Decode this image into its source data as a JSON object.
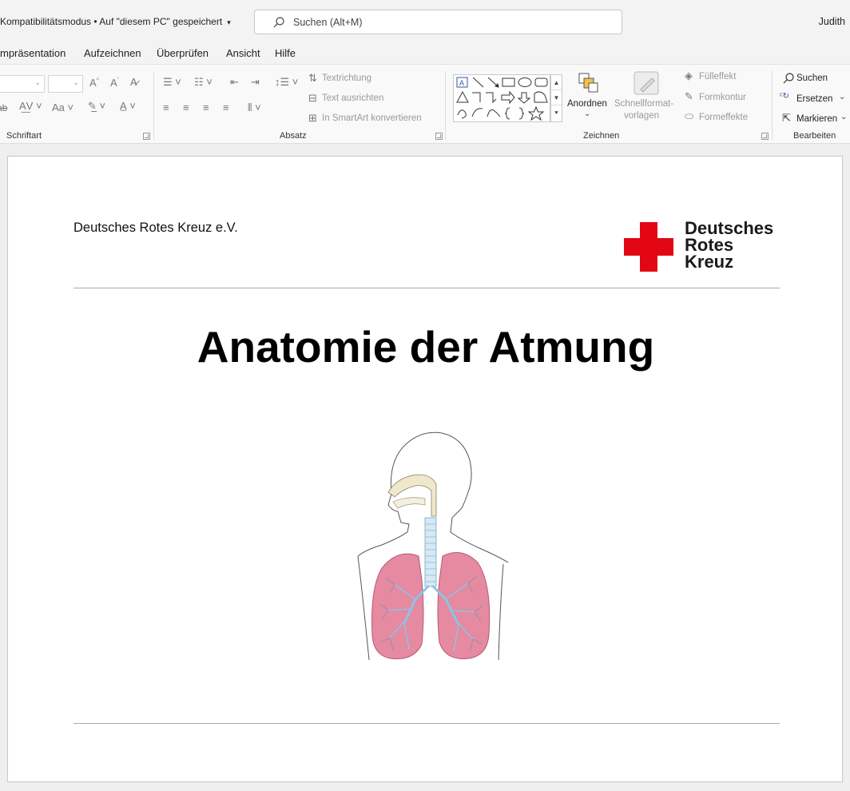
{
  "titlebar": {
    "doc_title": "Kompatibilitätsmodus • Auf \"diesem PC\" gespeichert",
    "search_placeholder": "Suchen (Alt+M)",
    "user_name": "Judith"
  },
  "tabs": [
    "mpräsentation",
    "Aufzeichnen",
    "Überprüfen",
    "Ansicht",
    "Hilfe"
  ],
  "ribbon": {
    "groups": {
      "font": "Schriftart",
      "paragraph": "Absatz",
      "drawing": "Zeichnen",
      "editing": "Bearbeiten"
    },
    "paragraph": {
      "text_direction": "Textrichtung",
      "align_text": "Text ausrichten",
      "smartart": "In SmartArt konvertieren"
    },
    "drawing": {
      "arrange": "Anordnen",
      "quick_styles_1": "Schnellformat-",
      "quick_styles_2": "vorlagen",
      "fill": "Fülleffekt",
      "outline": "Formkontur",
      "effects": "Formeffekte"
    },
    "editing": {
      "find": "Suchen",
      "replace": "Ersetzen",
      "select": "Markieren"
    }
  },
  "slide": {
    "organization": "Deutsches Rotes Kreuz e.V.",
    "logo_lines": [
      "Deutsches",
      "Rotes",
      "Kreuz"
    ],
    "title": "Anatomie der Atmung"
  },
  "colors": {
    "drk_red": "#e30613",
    "lung_pink": "#e58aa0",
    "bronchi_blue": "#8cc4e6"
  }
}
